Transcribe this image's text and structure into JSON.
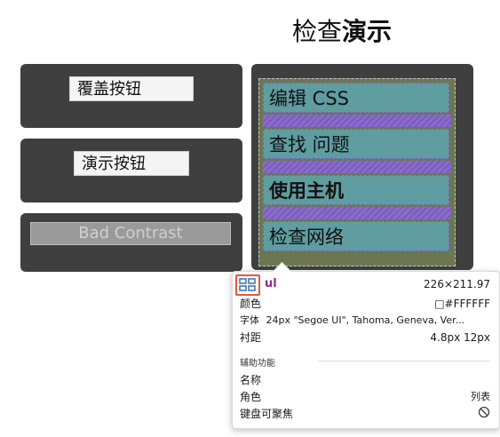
{
  "header": {
    "title_light": "检查",
    "title_bold": "演示"
  },
  "left_buttons": {
    "override": "覆盖按钮",
    "demo": "演示按钮",
    "bad_contrast": "Bad Contrast"
  },
  "list": {
    "items": [
      {
        "label": "编辑 CSS"
      },
      {
        "label": "查找 问题"
      },
      {
        "label": "使用主机"
      },
      {
        "label": "检查网络"
      }
    ]
  },
  "tooltip": {
    "element_tag": "ul",
    "size": "226×211.97",
    "color_label": "颜色",
    "color_value": "□#FFFFFF",
    "font_label": "字体",
    "font_value": "24px \"Segoe UI\", Tahoma, Geneva, Ver...",
    "padding_label": "衬距",
    "padding_value": "4.8px 12px",
    "accessibility_heading": "辅助功能",
    "name_label": "名称",
    "role_label": "角色",
    "role_value": "列表",
    "focusable_label": "键盘可聚焦"
  }
}
